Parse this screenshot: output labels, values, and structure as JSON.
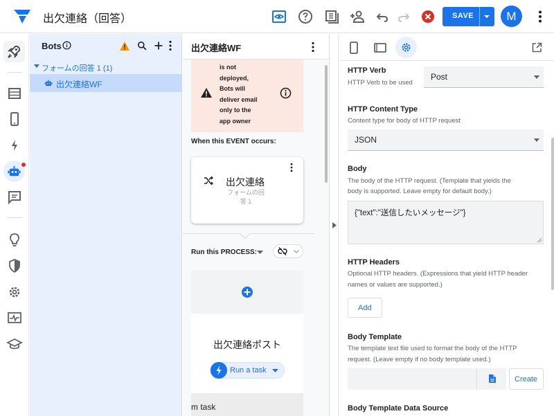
{
  "app": {
    "title": "出欠連絡（回答）"
  },
  "toolbar": {
    "save_label": "SAVE",
    "avatar_letter": "M"
  },
  "bots_panel": {
    "title": "Bots",
    "tree_parent": "フォームの回答 1 (1)",
    "tree_child": "出欠連絡WF"
  },
  "flow": {
    "title": "出欠連絡WF",
    "warning_lines": [
      "is not",
      "deployed,",
      "Bots will",
      "deliver email",
      "only to the",
      "app owner"
    ],
    "event_label": "When this EVENT occurs:",
    "event_name": "出欠連絡",
    "event_sub": "フォームの回答 1",
    "process_label": "Run this PROCESS:",
    "task_title": "出欠連絡ポスト",
    "run_task_label": "Run a task",
    "next_item": "m task"
  },
  "settings": {
    "http_verb": {
      "label": "HTTP Verb",
      "desc": "HTTP Verb to be used",
      "value": "Post"
    },
    "content_type": {
      "label": "HTTP Content Type",
      "desc": "Content type for body of HTTP request",
      "value": "JSON"
    },
    "body": {
      "label": "Body",
      "desc1": "The body of the HTTP request. (Template that yields the",
      "desc2": "body is supported. Leave empty for default body.)",
      "value": "{\"text\":\"送信したいメッセージ\"}"
    },
    "headers": {
      "label": "HTTP Headers",
      "desc1": "Optional HTTP headers. (Expressions that yield HTTP header",
      "desc2": "names or values are supported.)",
      "add_label": "Add"
    },
    "template": {
      "label": "Body Template",
      "desc1": "The template text file used to format the body of the HTTP",
      "desc2": "request. (Leave empty if no body template used.)",
      "create_label": "Create"
    },
    "template_source": {
      "label": "Body Template Data Source"
    }
  },
  "colors": {
    "accent": "#1a73e8",
    "warning_bg": "#fce8e0",
    "panel_bg": "#e8f0fe",
    "error": "#d93025",
    "warn_icon": "#f29900"
  }
}
